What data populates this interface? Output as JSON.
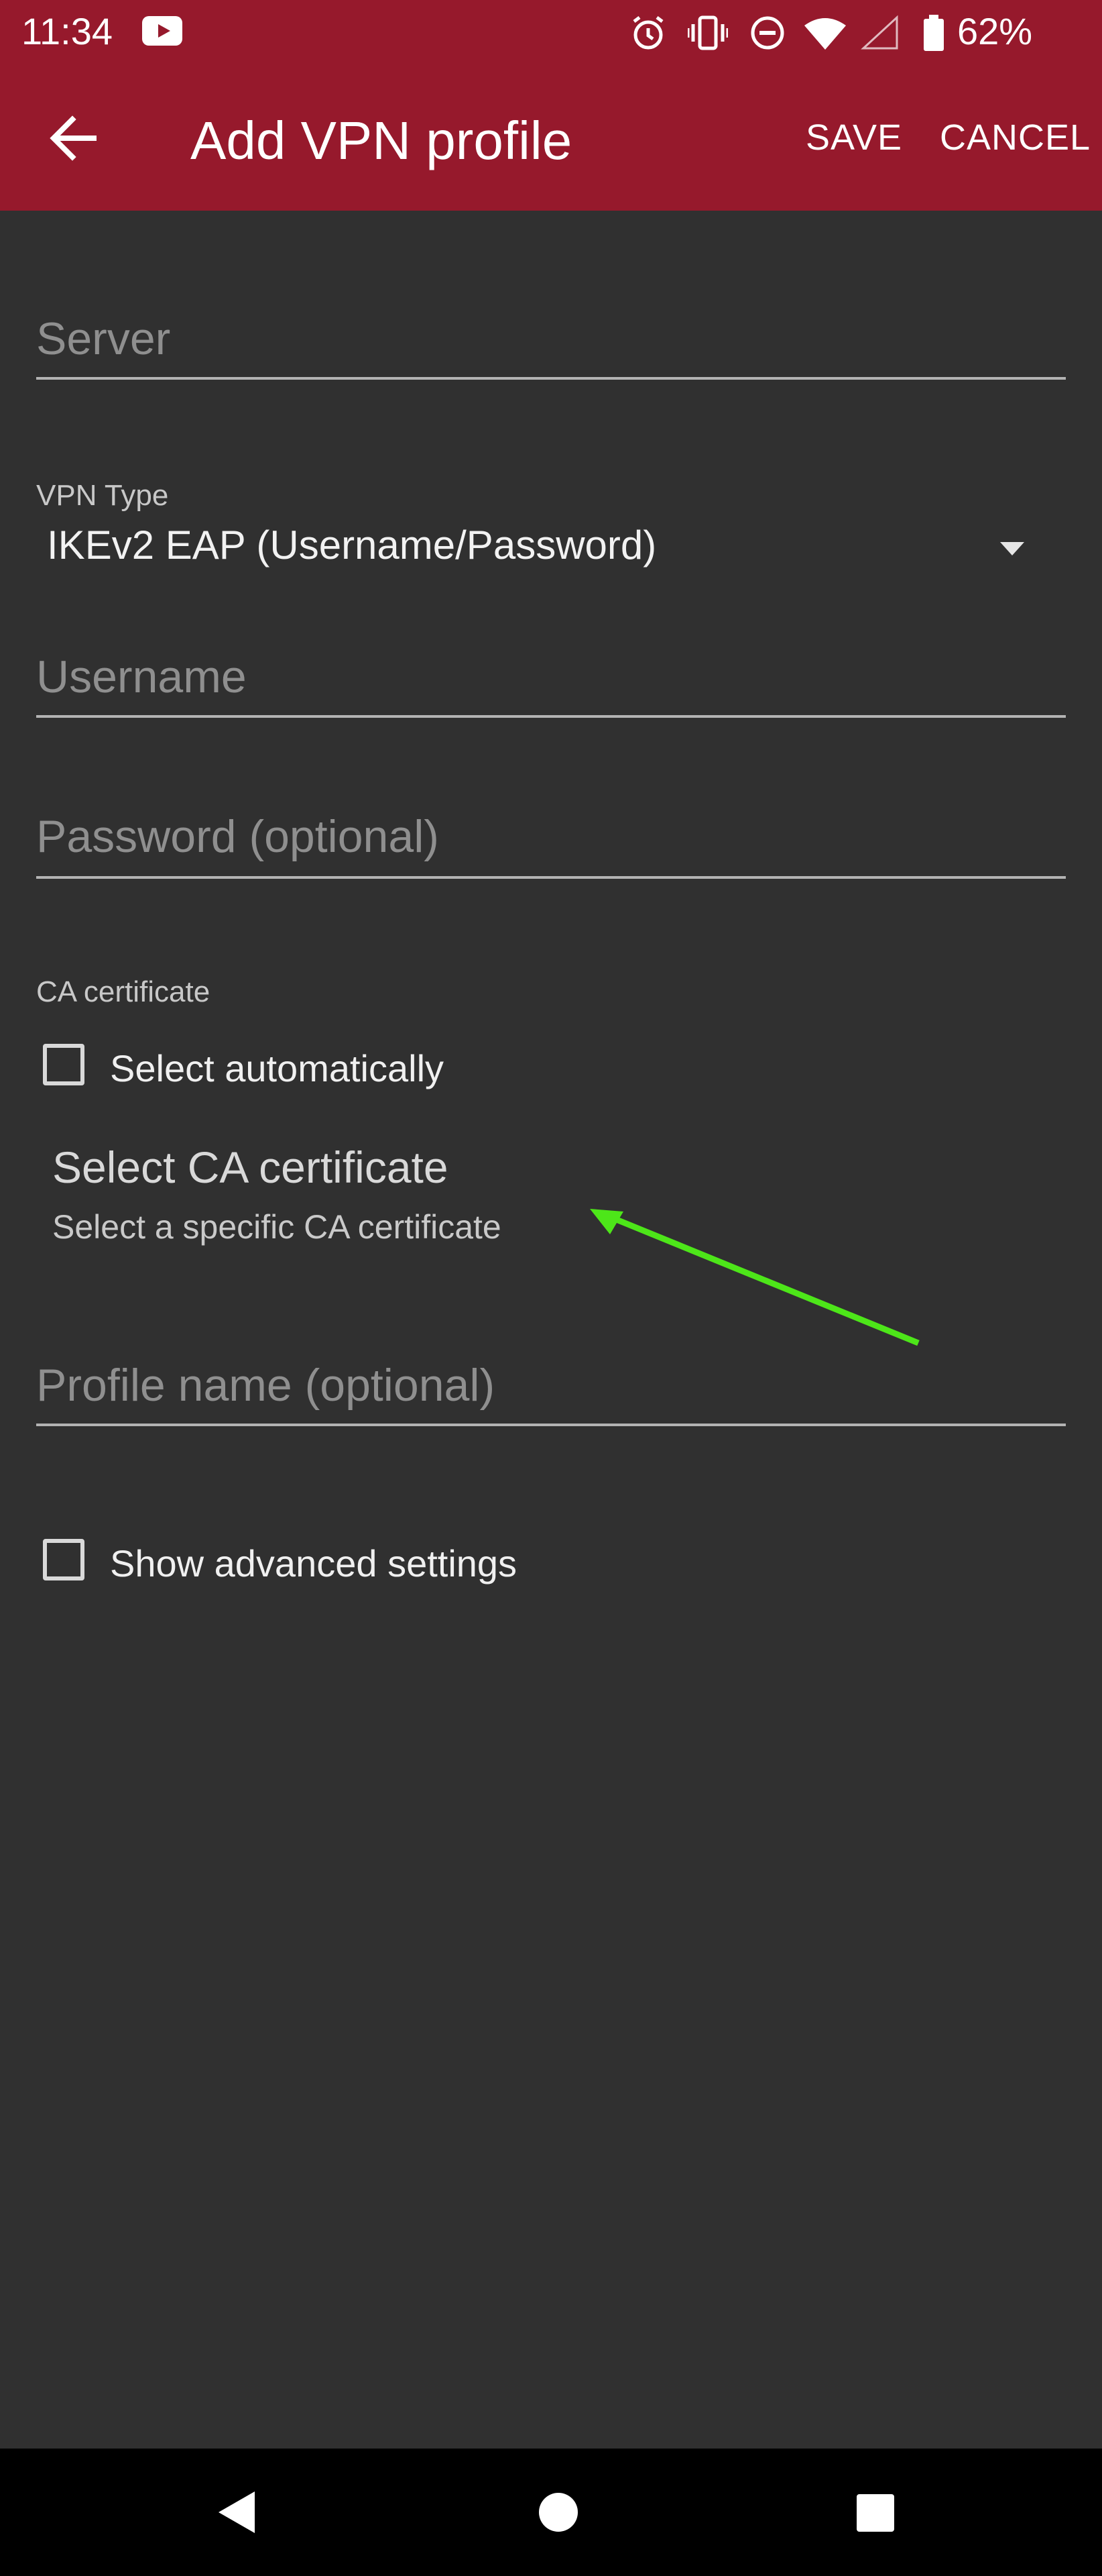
{
  "status_bar": {
    "time": "11:34",
    "battery_text": "62%",
    "icons": [
      "youtube-icon",
      "alarm-icon",
      "vibrate-icon",
      "do-not-disturb-icon",
      "wifi-icon",
      "signal-icon",
      "battery-icon"
    ]
  },
  "app_bar": {
    "title": "Add VPN profile",
    "save_label": "SAVE",
    "cancel_label": "CANCEL"
  },
  "form": {
    "server_placeholder": "Server",
    "vpn_type_label": "VPN Type",
    "vpn_type_value": "IKEv2 EAP (Username/Password)",
    "username_placeholder": "Username",
    "password_placeholder": "Password (optional)",
    "ca_label": "CA certificate",
    "select_auto_label": "Select automatically",
    "select_ca_title": "Select CA certificate",
    "select_ca_subtitle": "Select a specific CA certificate",
    "profile_name_placeholder": "Profile name (optional)",
    "show_advanced_label": "Show advanced settings"
  },
  "colors": {
    "accent": "#96192c",
    "background": "#303030",
    "annotation": "#4de619"
  }
}
